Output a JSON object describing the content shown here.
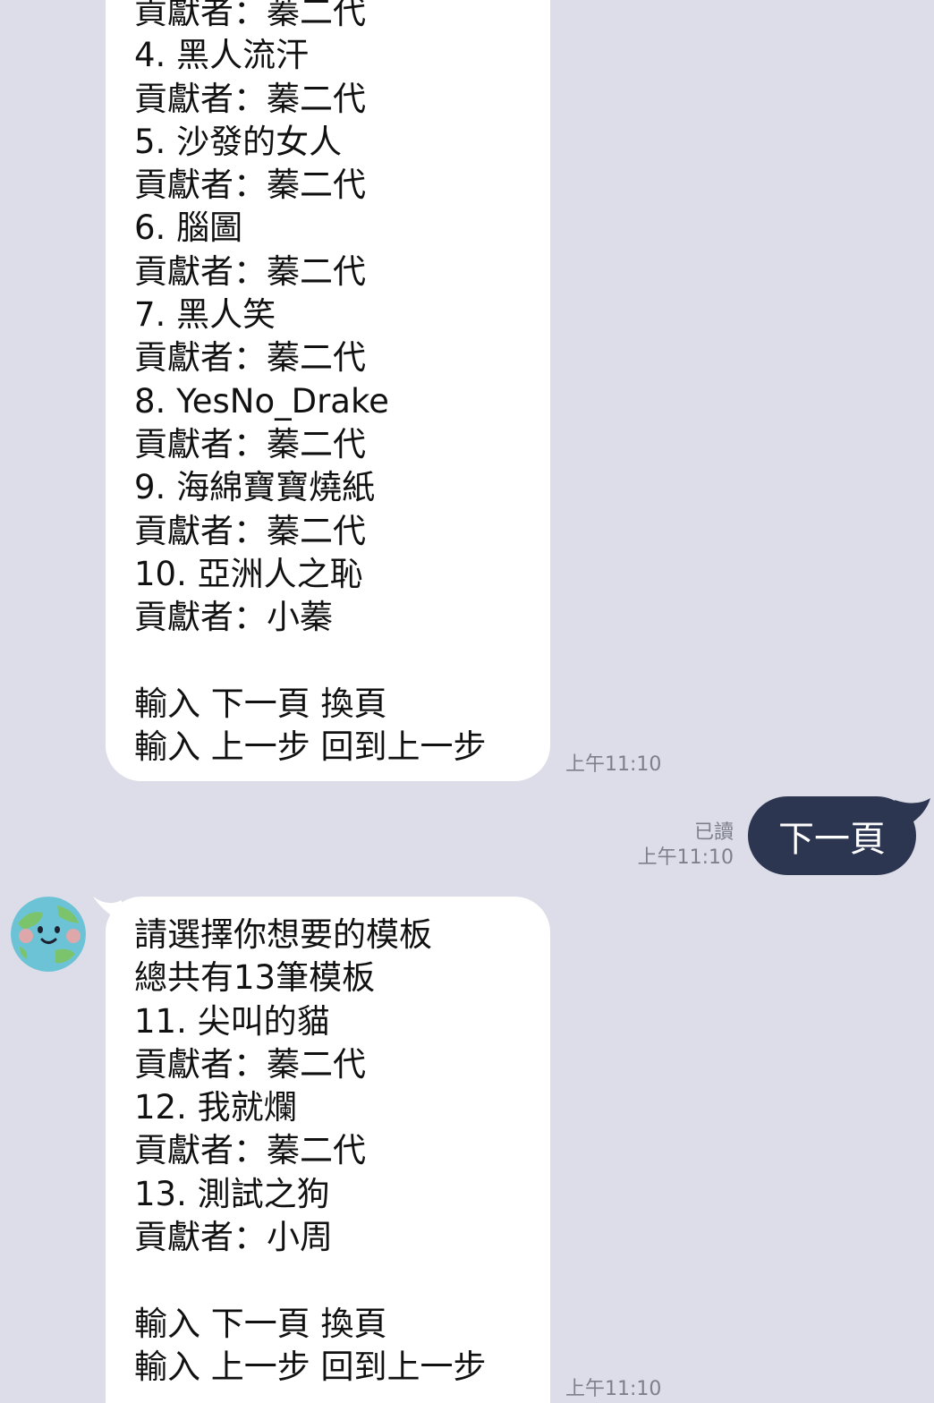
{
  "colors": {
    "background": "#dcdde8",
    "bubble_in": "#ffffff",
    "bubble_out": "#2d3650"
  },
  "message1": {
    "lines": [
      "貢獻者：蓁二代",
      "4. 黑人流汗",
      "貢獻者：蓁二代",
      "5. 沙發的女人",
      "貢獻者：蓁二代",
      "6. 腦圖",
      "貢獻者：蓁二代",
      "7. 黑人笑",
      "貢獻者：蓁二代",
      "8. YesNo_Drake",
      "貢獻者：蓁二代",
      "9. 海綿寶寶燒紙",
      "貢獻者：蓁二代",
      "10. 亞洲人之恥",
      "貢獻者：小蓁",
      "",
      "輸入 下一頁 換頁",
      "輸入 上一步 回到上一步"
    ],
    "time": "上午11:10"
  },
  "sent_message": {
    "text": "下一頁",
    "read_label": "已讀",
    "time": "上午11:10"
  },
  "message2": {
    "avatar_icon": "earth-face-icon",
    "lines": [
      "請選擇你想要的模板",
      "總共有13筆模板",
      "11. 尖叫的貓",
      "貢獻者：蓁二代",
      "12. 我就爛",
      "貢獻者：蓁二代",
      "13. 測試之狗",
      "貢獻者：小周",
      "",
      "輸入 下一頁 換頁",
      "輸入 上一步 回到上一步"
    ],
    "time": "上午11:10"
  }
}
